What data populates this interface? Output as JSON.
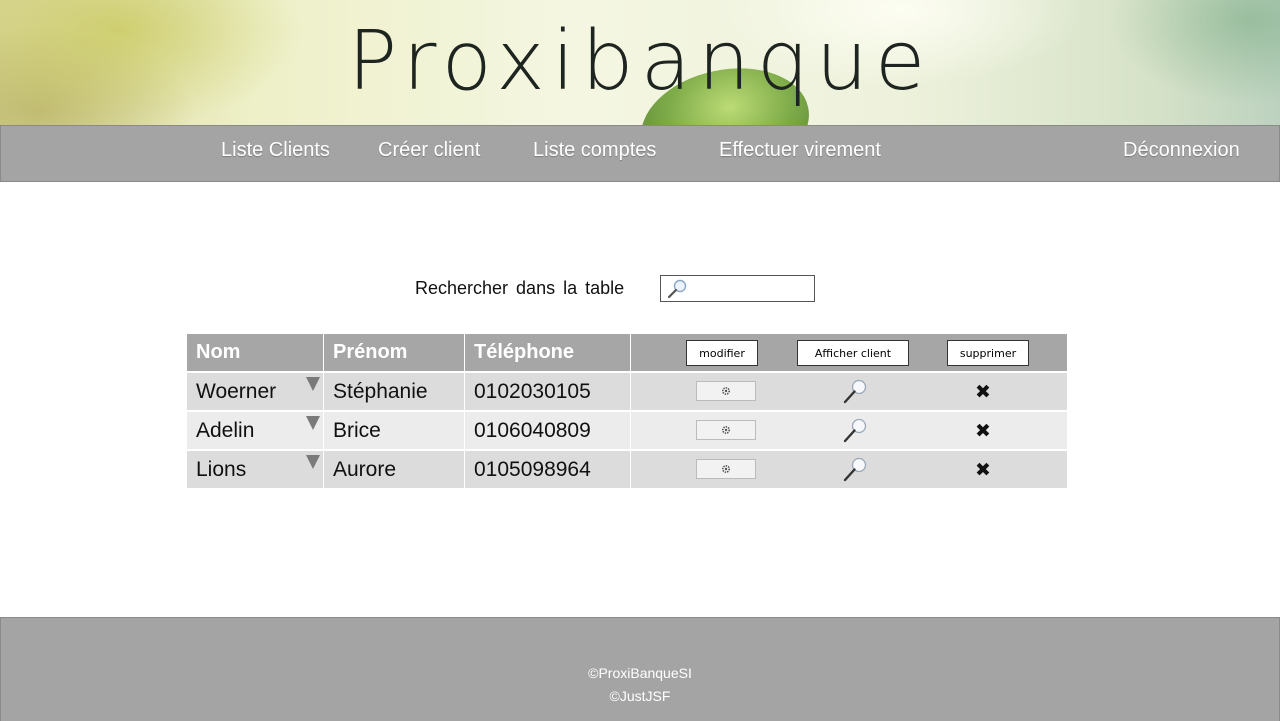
{
  "header": {
    "logo_text": "Proxibanque"
  },
  "nav": {
    "items": [
      {
        "label": "Liste Clients"
      },
      {
        "label": "Créer client"
      },
      {
        "label": "Liste comptes"
      },
      {
        "label": "Effectuer virement"
      }
    ],
    "logout": "Déconnexion"
  },
  "search": {
    "label": "Rechercher  dans la table",
    "value": ""
  },
  "table": {
    "columns": [
      "Nom",
      "Prénom",
      "Téléphone"
    ],
    "actions": {
      "edit": "modifier",
      "view": "Afficher client",
      "delete": "supprimer"
    },
    "rows": [
      {
        "nom": "Woerner",
        "prenom": "Stéphanie",
        "telephone": "0102030105"
      },
      {
        "nom": "Adelin",
        "prenom": "Brice",
        "telephone": "0106040809"
      },
      {
        "nom": "Lions",
        "prenom": "Aurore",
        "telephone": "0105098964"
      }
    ],
    "icons": {
      "edit": "gear-icon",
      "view": "magnifier-icon",
      "delete": "cross-icon",
      "sort": "triangle-down-icon"
    }
  },
  "footer": {
    "line1": "©ProxiBanqueSI",
    "line2": "©JustJSF"
  }
}
